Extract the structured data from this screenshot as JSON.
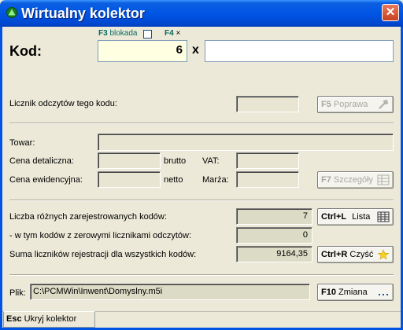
{
  "window": {
    "title": "Wirtualny kolektor",
    "close_glyph": "✕"
  },
  "hints": {
    "f3_key": "F3",
    "f3_text": "blokada",
    "f4_key": "F4",
    "f4_glyph": "×"
  },
  "code": {
    "label": "Kod:",
    "quantity": "6",
    "multiplier": "x",
    "value": ""
  },
  "counter": {
    "label": "Licznik odczytów tego kodu:",
    "value": "",
    "fix_key": "F5",
    "fix_label": "Poprawa"
  },
  "product": {
    "towar_label": "Towar:",
    "towar_value": "",
    "retail_price_label": "Cena detaliczna:",
    "retail_price_value": "",
    "brutto_label": "brutto",
    "vat_label": "VAT:",
    "vat_value": "",
    "book_price_label": "Cena ewidencyjna:",
    "book_price_value": "",
    "netto_label": "netto",
    "margin_label": "Marża:",
    "margin_value": "",
    "details_key": "F7",
    "details_label": "Szczegóły"
  },
  "stats": {
    "distinct_label": "Liczba różnych zarejestrowanych kodów:",
    "distinct_value": "7",
    "list_key": "Ctrl+L",
    "list_label": "Lista",
    "zero_label": "- w tym kodów z zerowymi licznikami odczytów:",
    "zero_value": "0",
    "sum_label": "Suma liczników rejestracji dla wszystkich kodów:",
    "sum_value": "9164,35",
    "clear_key": "Ctrl+R",
    "clear_label": "Czyść"
  },
  "file": {
    "label": "Plik:",
    "path": "C:\\PCMWin\\Inwent\\Domyslny.m5i",
    "change_key": "F10",
    "change_label": "Zmiana"
  },
  "footer": {
    "hide_key": "Esc",
    "hide_label": "Ukryj kolektor"
  },
  "colors": {
    "titlebar": "#0055e5",
    "hint_text": "#0a6a5f",
    "readonly_field": "#dcdbc5",
    "code_qty_bg": "#ffffe1"
  }
}
